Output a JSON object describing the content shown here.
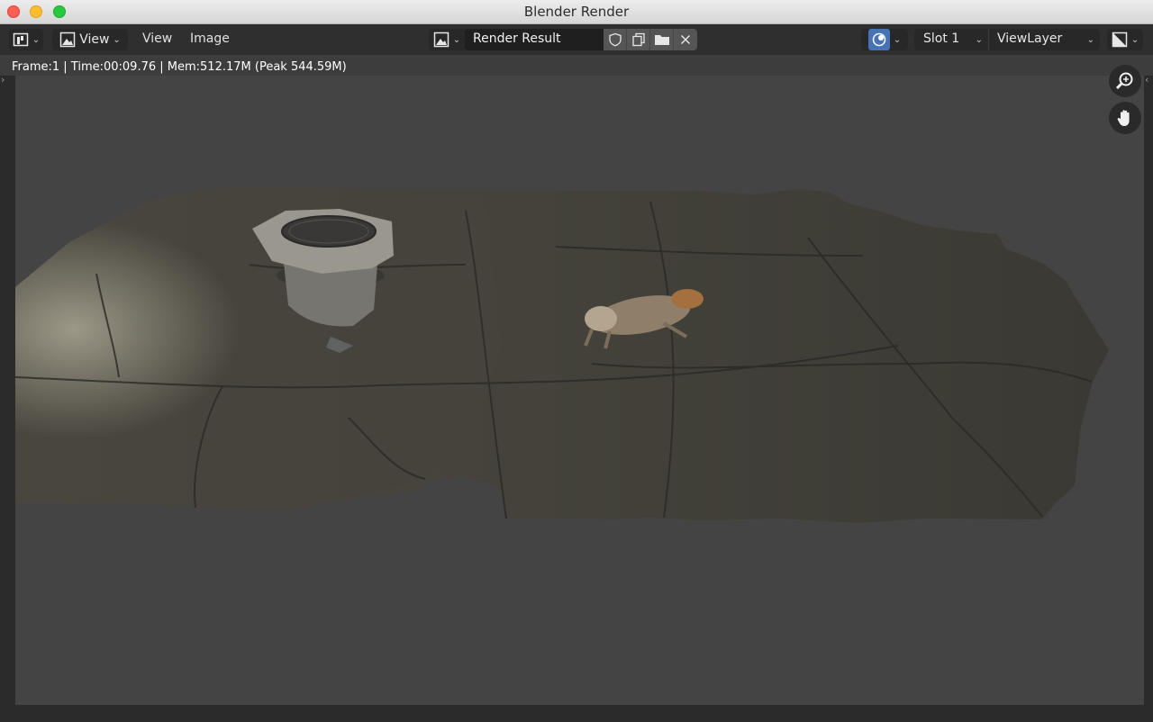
{
  "window": {
    "title": "Blender Render"
  },
  "header": {
    "editor_type_icon": "image-editor-icon",
    "view_menu_label": "View",
    "menus": [
      "View",
      "Image"
    ],
    "image_browse_icon": "image-browse-icon",
    "image_name": "Render Result",
    "image_actions": [
      "fake-user-shield-icon",
      "new-image-icon",
      "open-folder-icon",
      "close-icon"
    ],
    "overlay_icon": "overlay-icon",
    "slot_label": "Slot 1",
    "view_layer_label": "ViewLayer",
    "display_channel_icon": "display-channels-icon"
  },
  "status": {
    "text": "Frame:1 | Time:00:09.76 | Mem:512.17M (Peak 544.59M)"
  },
  "navigation": [
    "zoom-icon",
    "pan-hand-icon"
  ],
  "colors": {
    "accent": "#4772b3",
    "viewport_bg": "#444444",
    "header_bg": "#2f2f2f"
  }
}
